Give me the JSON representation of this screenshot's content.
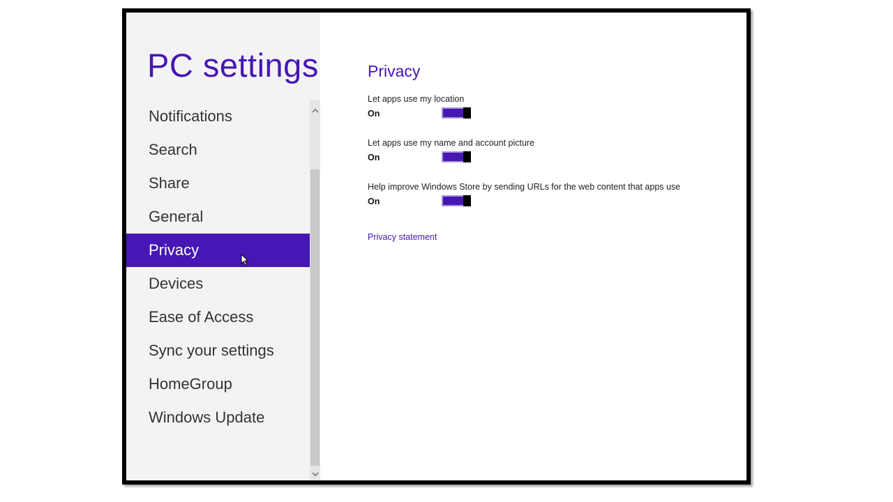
{
  "app": {
    "title": "PC settings"
  },
  "sidebar": {
    "items": [
      {
        "label": "Notifications"
      },
      {
        "label": "Search"
      },
      {
        "label": "Share"
      },
      {
        "label": "General"
      },
      {
        "label": "Privacy",
        "selected": true
      },
      {
        "label": "Devices"
      },
      {
        "label": "Ease of Access"
      },
      {
        "label": "Sync your settings"
      },
      {
        "label": "HomeGroup"
      },
      {
        "label": "Windows Update"
      }
    ]
  },
  "main": {
    "section_title": "Privacy",
    "settings": [
      {
        "label": "Let apps use my location",
        "state": "On"
      },
      {
        "label": "Let apps use my name and account picture",
        "state": "On"
      },
      {
        "label": "Help improve Windows Store by sending URLs for the web content that apps use",
        "state": "On"
      }
    ],
    "link": "Privacy statement"
  },
  "icons": {
    "scroll_up": "chevron-up-icon",
    "scroll_down": "chevron-down-icon",
    "cursor": "mouse-pointer-icon"
  },
  "colors": {
    "accent": "#4617b4",
    "sidebar_bg": "#f3f3f3",
    "frame_border": "#000000",
    "toggle_thumb": "#000000"
  }
}
